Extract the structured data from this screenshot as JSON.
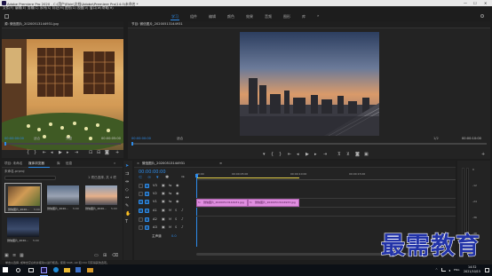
{
  "titlebar": {
    "title": "Adobe Premiere Pro 2020 - C:\\用户\\Ebin\\文档\\Adobe\\Premiere Pro\\14.0\\未命名 *",
    "menu": [
      "文件(F)",
      "编辑(E)",
      "剪辑(C)",
      "序列(S)",
      "标记(M)",
      "图形(G)",
      "视图(V)",
      "窗口(W)",
      "帮助(H)"
    ],
    "window_controls": [
      "—",
      "☐",
      "✕"
    ]
  },
  "workspaces": {
    "items": [
      "学习",
      "组件",
      "编辑",
      "颜色",
      "效果",
      "音频",
      "图形",
      "库"
    ],
    "active_index": 0,
    "more": "»"
  },
  "source_monitor": {
    "tab_label": "源: 微信图片_20200513144931.jpg",
    "timecode_left": "00:00:00:00",
    "fit_label": "适合",
    "ratio_label": "完整",
    "timecode_right": "00:00:05:00"
  },
  "program_monitor": {
    "tab_label": "节目: 微信图片_20200513144931",
    "timecode_left": "00:00:00:00",
    "fit_label": "适合",
    "ratio_label": "1/2",
    "timecode_right": "00:00:10:00"
  },
  "project_panel": {
    "tabs": [
      "项目: 未命名",
      "媒体浏览器",
      "库",
      "信息"
    ],
    "active_tab_index": 1,
    "path_label": "未命名.prproj",
    "search_placeholder": "",
    "count_label": "1 项已选择, 共 4 项",
    "items": [
      {
        "name": "微信图片_2020...",
        "duration": "5:00",
        "kind": "interior"
      },
      {
        "name": "微信图片_2020...",
        "duration": "5:00",
        "kind": "city"
      },
      {
        "name": "微信图片_2020...",
        "duration": "5:00",
        "kind": "sunset"
      },
      {
        "name": "微信图片_2020...",
        "duration": "5:00",
        "kind": "night"
      }
    ]
  },
  "timeline": {
    "tab_label": "微信图片_20200513144931",
    "timecode": "00:00:00:00",
    "ruler": [
      "00:00",
      "00:00:05:00",
      "00:00:10:00",
      "00:00:15:00"
    ],
    "tracks": [
      {
        "label": "V3",
        "kind": "video"
      },
      {
        "label": "V2",
        "kind": "video"
      },
      {
        "label": "V1",
        "kind": "video"
      },
      {
        "label": "A1",
        "kind": "audio"
      },
      {
        "label": "A2",
        "kind": "audio"
      },
      {
        "label": "A3",
        "kind": "audio"
      }
    ],
    "master_label": "主声道",
    "master_value": "0.0",
    "clips": [
      {
        "label": "微信图片_20200513144931.jpg"
      },
      {
        "label": "微信图片_20200513144933.jpg"
      }
    ],
    "meter_scale": [
      "0",
      "-12",
      "-24",
      "-36",
      "-48",
      "dB"
    ]
  },
  "status_bar": {
    "text": "单击以选择, 或单击空白处并拖动以进行框选。使用 Shift, Alt 和 Ctrl 可获得其他选项。"
  },
  "taskbar": {
    "apps": [
      "windows-icon",
      "search-icon",
      "task-view-icon",
      "premiere-icon",
      "edge-icon",
      "explorer-icon",
      "store-icon",
      "folder-icon"
    ],
    "time": "14:32",
    "date": "2021/10/15",
    "tray": [
      "^",
      "ENG"
    ]
  },
  "watermark": {
    "text": "最需教育"
  },
  "colors": {
    "accent": "#2d8ceb",
    "clip": "#e08ee0",
    "panel_bg": "#232323",
    "app_bg": "#1d1d1d",
    "taskbar_bg": "#0c1016",
    "watermark": "#2233a8"
  }
}
